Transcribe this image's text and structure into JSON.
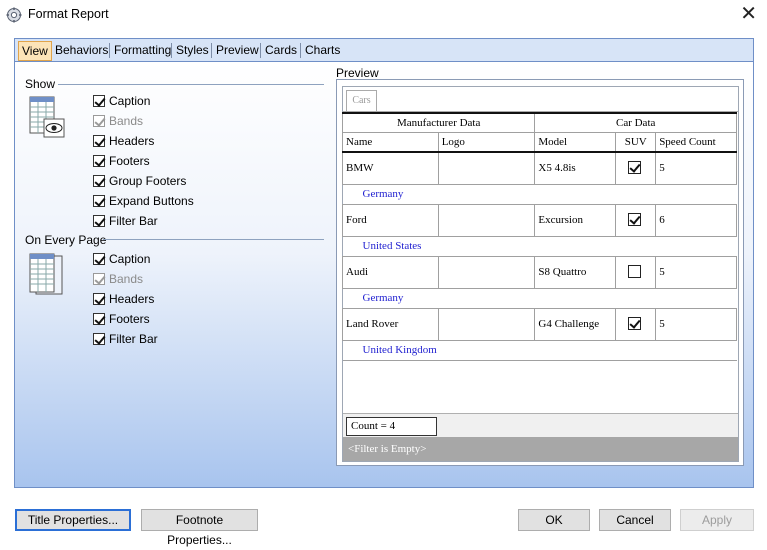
{
  "window": {
    "title": "Format Report",
    "icon": "gear-icon",
    "close_glyph": "✕"
  },
  "tabs": [
    "View",
    "Behaviors",
    "Formatting",
    "Styles",
    "Preview",
    "Cards",
    "Charts"
  ],
  "active_tab": "View",
  "show": {
    "label": "Show",
    "options": [
      {
        "label": "Caption",
        "checked": true,
        "enabled": true
      },
      {
        "label": "Bands",
        "checked": true,
        "enabled": false
      },
      {
        "label": "Headers",
        "checked": true,
        "enabled": true
      },
      {
        "label": "Footers",
        "checked": true,
        "enabled": true
      },
      {
        "label": "Group Footers",
        "checked": true,
        "enabled": true
      },
      {
        "label": "Expand Buttons",
        "checked": true,
        "enabled": true
      },
      {
        "label": "Filter Bar",
        "checked": true,
        "enabled": true
      }
    ]
  },
  "every_page": {
    "label": "On Every Page",
    "options": [
      {
        "label": "Caption",
        "checked": true,
        "enabled": true
      },
      {
        "label": "Bands",
        "checked": true,
        "enabled": false
      },
      {
        "label": "Headers",
        "checked": true,
        "enabled": true
      },
      {
        "label": "Footers",
        "checked": true,
        "enabled": true
      },
      {
        "label": "Filter Bar",
        "checked": true,
        "enabled": true
      }
    ]
  },
  "preview": {
    "label": "Preview",
    "caption": "Cars",
    "bands": [
      "Manufacturer Data",
      "Car Data"
    ],
    "columns": [
      "Name",
      "Logo",
      "Model",
      "SUV",
      "Speed Count"
    ],
    "groups": [
      {
        "name": "BMW",
        "logo": "",
        "model": "X5 4.8is",
        "suv": true,
        "speed_count": "5",
        "country": "Germany"
      },
      {
        "name": "Ford",
        "logo": "",
        "model": "Excursion",
        "suv": true,
        "speed_count": "6",
        "country": "United States"
      },
      {
        "name": "Audi",
        "logo": "",
        "model": "S8 Quattro",
        "suv": false,
        "speed_count": "5",
        "country": "Germany"
      },
      {
        "name": "Land Rover",
        "logo": "",
        "model": "G4 Challenge",
        "suv": true,
        "speed_count": "5",
        "country": "United Kingdom"
      }
    ],
    "footer_count": "Count = 4",
    "filter_text": "<Filter is Empty>"
  },
  "buttons": {
    "title_properties": "Title Properties...",
    "footnote_properties": "Footnote Properties...",
    "ok": "OK",
    "cancel": "Cancel",
    "apply": "Apply"
  }
}
